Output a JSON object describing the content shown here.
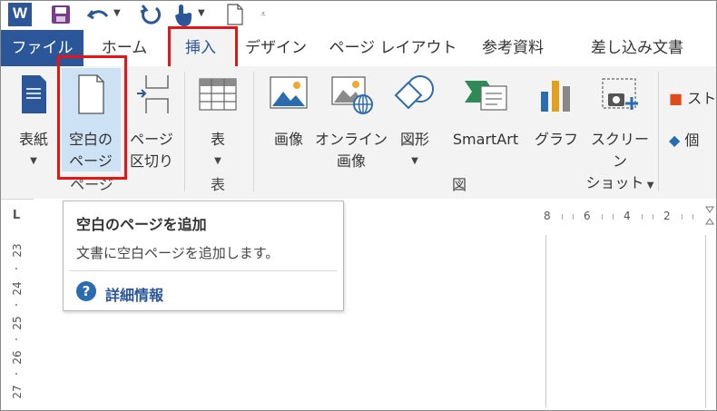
{
  "qat": {
    "app_icon": "W",
    "icons": [
      "word-icon",
      "save-icon",
      "undo-icon",
      "redo-icon",
      "touch-mode-icon",
      "new-document-icon",
      "customize-qat-icon"
    ]
  },
  "tabs": [
    {
      "label": "ファイル",
      "type": "file"
    },
    {
      "label": "ホーム"
    },
    {
      "label": "挿入",
      "active": true
    },
    {
      "label": "デザイン"
    },
    {
      "label": "ページ レイアウト"
    },
    {
      "label": "参考資料"
    },
    {
      "label": "差し込み文書"
    }
  ],
  "ribbon": {
    "pages_group": {
      "label": "ページ",
      "cover": {
        "line1": "表紙"
      },
      "blank": {
        "line1": "空白の",
        "line2": "ページ"
      },
      "break": {
        "line1": "ページ",
        "line2": "区切り"
      }
    },
    "tables_group": {
      "label": "表",
      "table": {
        "line1": "表"
      }
    },
    "illustrations_group": {
      "label": "図",
      "picture": {
        "line1": "画像"
      },
      "online": {
        "line1": "オンライン",
        "line2": "画像"
      },
      "shapes": {
        "line1": "図形"
      },
      "smartart": {
        "line1": "SmartArt"
      },
      "chart": {
        "line1": "グラフ"
      },
      "screenshot": {
        "line1": "スクリーン",
        "line2": "ショット"
      }
    },
    "addins": {
      "store": "スト",
      "myaddins": "個"
    }
  },
  "ruler": {
    "corner": "L",
    "h_numbers": [
      "8",
      "6",
      "4",
      "2"
    ],
    "v_numbers": [
      "23",
      "24",
      "25",
      "26",
      "27"
    ]
  },
  "tooltip": {
    "title": "空白のページを追加",
    "description": "文書に空白ページを追加します。",
    "help_link": "詳細情報",
    "help_glyph": "?"
  },
  "colors": {
    "accent": "#2b579a",
    "highlight": "#e11111",
    "ribbon_bg": "#f3f3f3"
  }
}
